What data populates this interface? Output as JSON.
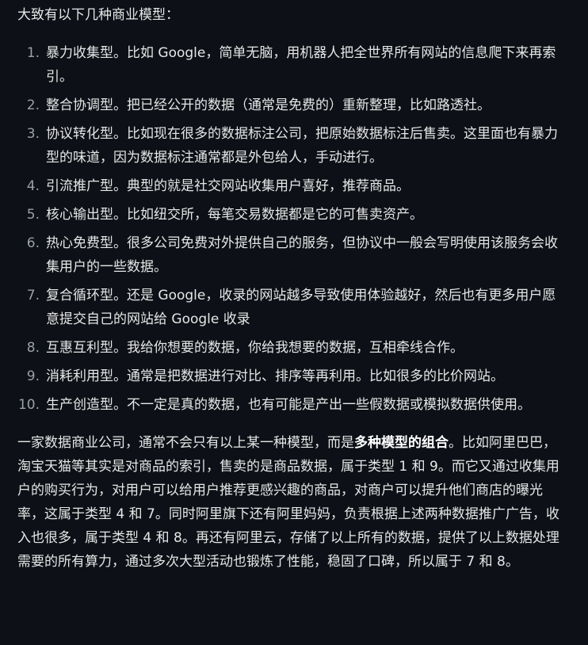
{
  "intro": "大致有以下几种商业模型：",
  "items": [
    {
      "num": "1.",
      "text": "暴力收集型。比如 Google，简单无脑，用机器人把全世界所有网站的信息爬下来再索引。"
    },
    {
      "num": "2.",
      "text": "整合协调型。把已经公开的数据（通常是免费的）重新整理，比如路透社。"
    },
    {
      "num": "3.",
      "text": "协议转化型。比如现在很多的数据标注公司，把原始数据标注后售卖。这里面也有暴力型的味道，因为数据标注通常都是外包给人，手动进行。"
    },
    {
      "num": "4.",
      "text": "引流推广型。典型的就是社交网站收集用户喜好，推荐商品。"
    },
    {
      "num": "5.",
      "text": "核心输出型。比如纽交所，每笔交易数据都是它的可售卖资产。"
    },
    {
      "num": "6.",
      "text": "热心免费型。很多公司免费对外提供自己的服务，但协议中一般会写明使用该服务会收集用户的一些数据。"
    },
    {
      "num": "7.",
      "text": "复合循环型。还是 Google，收录的网站越多导致使用体验越好，然后也有更多用户愿意提交自己的网站给 Google 收录"
    },
    {
      "num": "8.",
      "text": "互惠互利型。我给你想要的数据，你给我想要的数据，互相牵线合作。"
    },
    {
      "num": "9.",
      "text": "消耗利用型。通常是把数据进行对比、排序等再利用。比如很多的比价网站。"
    },
    {
      "num": "10.",
      "text": "生产创造型。不一定是真的数据，也有可能是产出一些假数据或模拟数据供使用。"
    }
  ],
  "summary": {
    "before": "一家数据商业公司，通常不会只有以上某一种模型，而是",
    "bold": "多种模型的组合",
    "after": "。比如阿里巴巴，淘宝天猫等其实是对商品的索引，售卖的是商品数据，属于类型 1 和 9。而它又通过收集用户的购买行为，对用户可以给用户推荐更感兴趣的商品，对商户可以提升他们商店的曝光率，这属于类型 4 和 7。同时阿里旗下还有阿里妈妈，负责根据上述两种数据推广广告，收入也很多，属于类型 4 和 8。再还有阿里云，存储了以上所有的数据，提供了以上数据处理需要的所有算力，通过多次大型活动也锻炼了性能，稳固了口碑，所以属于 7 和 8。"
  }
}
